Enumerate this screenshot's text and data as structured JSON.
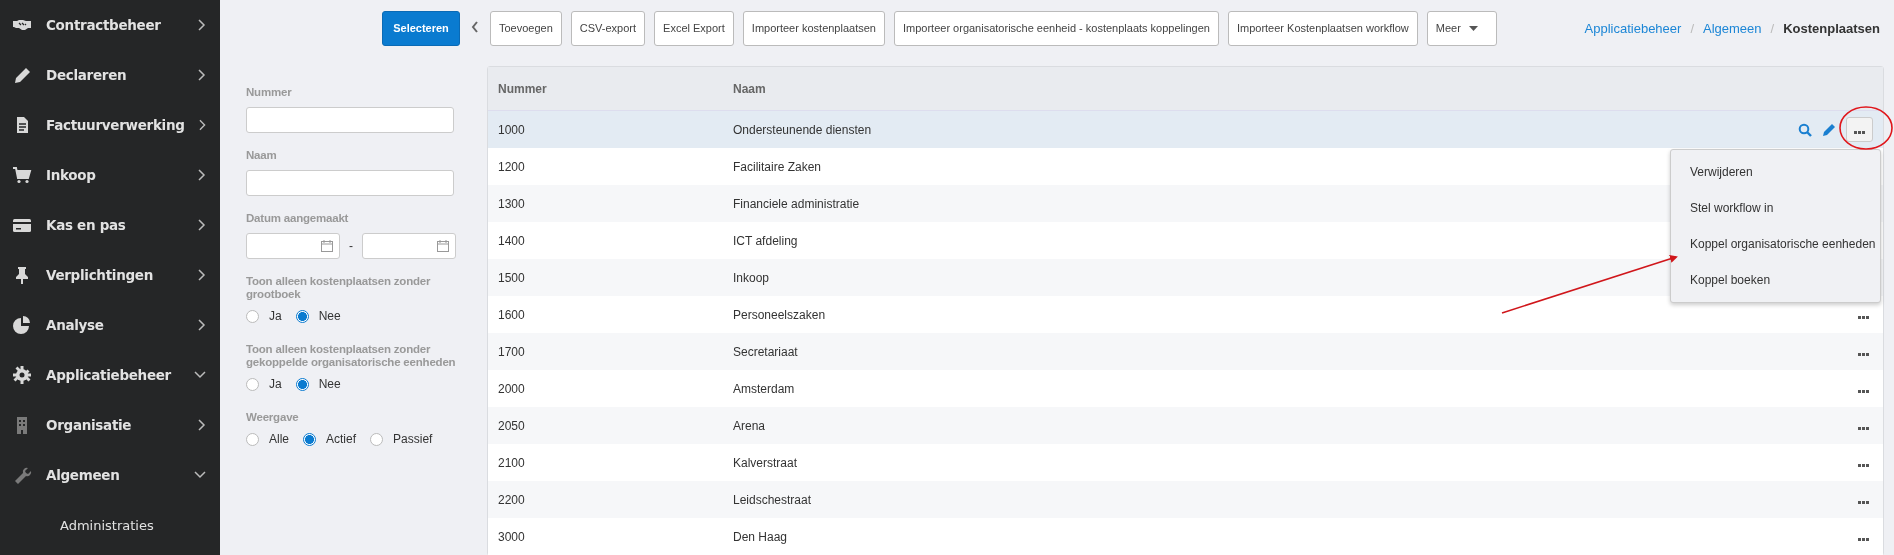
{
  "sidebar": {
    "items": [
      {
        "label": "Contractbeheer",
        "expanded": false
      },
      {
        "label": "Declareren",
        "expanded": false
      },
      {
        "label": "Factuurverwerking",
        "expanded": false
      },
      {
        "label": "Inkoop",
        "expanded": false
      },
      {
        "label": "Kas en pas",
        "expanded": false
      },
      {
        "label": "Verplichtingen",
        "expanded": false
      },
      {
        "label": "Analyse",
        "expanded": false
      },
      {
        "label": "Applicatiebeheer",
        "expanded": true
      },
      {
        "label": "Organisatie",
        "expanded": false
      },
      {
        "label": "Algemeen",
        "expanded": true,
        "children": [
          {
            "label": "Administraties"
          }
        ]
      }
    ]
  },
  "toolbar": {
    "primary": "Selecteren",
    "buttons": [
      "Toevoegen",
      "CSV-export",
      "Excel Export",
      "Importeer kostenplaatsen",
      "Importeer organisatorische eenheid - kostenplaats koppelingen",
      "Importeer Kostenplaatsen workflow"
    ],
    "more": "Meer"
  },
  "breadcrumb": {
    "links": [
      "Applicatiebeheer",
      "Algemeen"
    ],
    "current": "Kostenplaatsen",
    "separators": [
      "/",
      "/"
    ]
  },
  "filters": {
    "nummer": {
      "label": "Nummer"
    },
    "naam": {
      "label": "Naam"
    },
    "datum": {
      "label": "Datum aangemaakt",
      "separator": "-"
    },
    "groups": [
      {
        "label": "Toon alleen kostenplaatsen zonder grootboek",
        "options": [
          {
            "label": "Ja",
            "selected": false
          },
          {
            "label": "Nee",
            "selected": true
          }
        ]
      },
      {
        "label": "Toon alleen kostenplaatsen zonder gekoppelde organisatorische eenheden",
        "options": [
          {
            "label": "Ja",
            "selected": false
          },
          {
            "label": "Nee",
            "selected": true
          }
        ]
      },
      {
        "label": "Weergave",
        "options": [
          {
            "label": "Alle",
            "selected": false
          },
          {
            "label": "Actief",
            "selected": true
          },
          {
            "label": "Passief",
            "selected": false
          }
        ]
      }
    ]
  },
  "table": {
    "columns": [
      "Nummer",
      "Naam"
    ],
    "rows": [
      {
        "nummer": "1000",
        "naam": "Ondersteunende diensten",
        "selected": true,
        "kind": "actions"
      },
      {
        "nummer": "1200",
        "naam": "Facilitaire Zaken",
        "selected": false,
        "kind": "covered"
      },
      {
        "nummer": "1300",
        "naam": "Financiele administratie",
        "selected": false,
        "kind": "covered"
      },
      {
        "nummer": "1400",
        "naam": "ICT afdeling",
        "selected": false,
        "kind": "covered"
      },
      {
        "nummer": "1500",
        "naam": "Inkoop",
        "selected": false,
        "kind": "covered"
      },
      {
        "nummer": "1600",
        "naam": "Personeelszaken",
        "selected": false,
        "kind": "more"
      },
      {
        "nummer": "1700",
        "naam": "Secretariaat",
        "selected": false,
        "kind": "more"
      },
      {
        "nummer": "2000",
        "naam": "Amsterdam",
        "selected": false,
        "kind": "more"
      },
      {
        "nummer": "2050",
        "naam": "Arena",
        "selected": false,
        "kind": "more"
      },
      {
        "nummer": "2100",
        "naam": "Kalverstraat",
        "selected": false,
        "kind": "more"
      },
      {
        "nummer": "2200",
        "naam": "Leidschestraat",
        "selected": false,
        "kind": "more"
      },
      {
        "nummer": "3000",
        "naam": "Den Haag",
        "selected": false,
        "kind": "more"
      }
    ],
    "menu": {
      "items": [
        "Verwijderen",
        "Stel workflow in",
        "Koppel organisatorische eenheden",
        "Koppel boeken"
      ]
    }
  }
}
